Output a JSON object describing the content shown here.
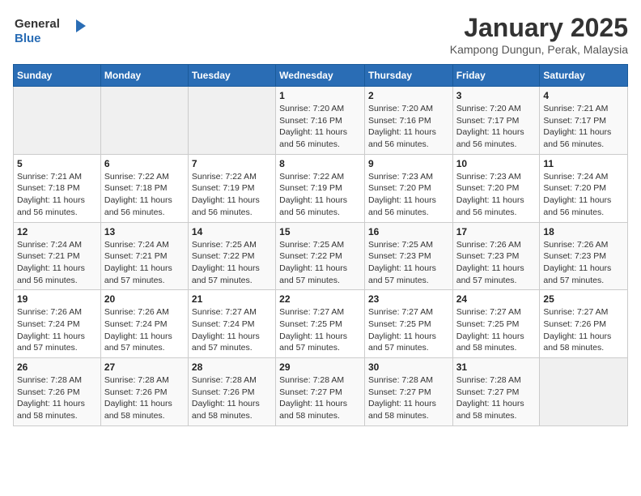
{
  "header": {
    "logo_general": "General",
    "logo_blue": "Blue",
    "title": "January 2025",
    "subtitle": "Kampong Dungun, Perak, Malaysia"
  },
  "days_of_week": [
    "Sunday",
    "Monday",
    "Tuesday",
    "Wednesday",
    "Thursday",
    "Friday",
    "Saturday"
  ],
  "weeks": [
    [
      {
        "day": "",
        "info": ""
      },
      {
        "day": "",
        "info": ""
      },
      {
        "day": "",
        "info": ""
      },
      {
        "day": "1",
        "info": "Sunrise: 7:20 AM\nSunset: 7:16 PM\nDaylight: 11 hours and 56 minutes."
      },
      {
        "day": "2",
        "info": "Sunrise: 7:20 AM\nSunset: 7:16 PM\nDaylight: 11 hours and 56 minutes."
      },
      {
        "day": "3",
        "info": "Sunrise: 7:20 AM\nSunset: 7:17 PM\nDaylight: 11 hours and 56 minutes."
      },
      {
        "day": "4",
        "info": "Sunrise: 7:21 AM\nSunset: 7:17 PM\nDaylight: 11 hours and 56 minutes."
      }
    ],
    [
      {
        "day": "5",
        "info": "Sunrise: 7:21 AM\nSunset: 7:18 PM\nDaylight: 11 hours and 56 minutes."
      },
      {
        "day": "6",
        "info": "Sunrise: 7:22 AM\nSunset: 7:18 PM\nDaylight: 11 hours and 56 minutes."
      },
      {
        "day": "7",
        "info": "Sunrise: 7:22 AM\nSunset: 7:19 PM\nDaylight: 11 hours and 56 minutes."
      },
      {
        "day": "8",
        "info": "Sunrise: 7:22 AM\nSunset: 7:19 PM\nDaylight: 11 hours and 56 minutes."
      },
      {
        "day": "9",
        "info": "Sunrise: 7:23 AM\nSunset: 7:20 PM\nDaylight: 11 hours and 56 minutes."
      },
      {
        "day": "10",
        "info": "Sunrise: 7:23 AM\nSunset: 7:20 PM\nDaylight: 11 hours and 56 minutes."
      },
      {
        "day": "11",
        "info": "Sunrise: 7:24 AM\nSunset: 7:20 PM\nDaylight: 11 hours and 56 minutes."
      }
    ],
    [
      {
        "day": "12",
        "info": "Sunrise: 7:24 AM\nSunset: 7:21 PM\nDaylight: 11 hours and 56 minutes."
      },
      {
        "day": "13",
        "info": "Sunrise: 7:24 AM\nSunset: 7:21 PM\nDaylight: 11 hours and 57 minutes."
      },
      {
        "day": "14",
        "info": "Sunrise: 7:25 AM\nSunset: 7:22 PM\nDaylight: 11 hours and 57 minutes."
      },
      {
        "day": "15",
        "info": "Sunrise: 7:25 AM\nSunset: 7:22 PM\nDaylight: 11 hours and 57 minutes."
      },
      {
        "day": "16",
        "info": "Sunrise: 7:25 AM\nSunset: 7:23 PM\nDaylight: 11 hours and 57 minutes."
      },
      {
        "day": "17",
        "info": "Sunrise: 7:26 AM\nSunset: 7:23 PM\nDaylight: 11 hours and 57 minutes."
      },
      {
        "day": "18",
        "info": "Sunrise: 7:26 AM\nSunset: 7:23 PM\nDaylight: 11 hours and 57 minutes."
      }
    ],
    [
      {
        "day": "19",
        "info": "Sunrise: 7:26 AM\nSunset: 7:24 PM\nDaylight: 11 hours and 57 minutes."
      },
      {
        "day": "20",
        "info": "Sunrise: 7:26 AM\nSunset: 7:24 PM\nDaylight: 11 hours and 57 minutes."
      },
      {
        "day": "21",
        "info": "Sunrise: 7:27 AM\nSunset: 7:24 PM\nDaylight: 11 hours and 57 minutes."
      },
      {
        "day": "22",
        "info": "Sunrise: 7:27 AM\nSunset: 7:25 PM\nDaylight: 11 hours and 57 minutes."
      },
      {
        "day": "23",
        "info": "Sunrise: 7:27 AM\nSunset: 7:25 PM\nDaylight: 11 hours and 57 minutes."
      },
      {
        "day": "24",
        "info": "Sunrise: 7:27 AM\nSunset: 7:25 PM\nDaylight: 11 hours and 58 minutes."
      },
      {
        "day": "25",
        "info": "Sunrise: 7:27 AM\nSunset: 7:26 PM\nDaylight: 11 hours and 58 minutes."
      }
    ],
    [
      {
        "day": "26",
        "info": "Sunrise: 7:28 AM\nSunset: 7:26 PM\nDaylight: 11 hours and 58 minutes."
      },
      {
        "day": "27",
        "info": "Sunrise: 7:28 AM\nSunset: 7:26 PM\nDaylight: 11 hours and 58 minutes."
      },
      {
        "day": "28",
        "info": "Sunrise: 7:28 AM\nSunset: 7:26 PM\nDaylight: 11 hours and 58 minutes."
      },
      {
        "day": "29",
        "info": "Sunrise: 7:28 AM\nSunset: 7:27 PM\nDaylight: 11 hours and 58 minutes."
      },
      {
        "day": "30",
        "info": "Sunrise: 7:28 AM\nSunset: 7:27 PM\nDaylight: 11 hours and 58 minutes."
      },
      {
        "day": "31",
        "info": "Sunrise: 7:28 AM\nSunset: 7:27 PM\nDaylight: 11 hours and 58 minutes."
      },
      {
        "day": "",
        "info": ""
      }
    ]
  ]
}
